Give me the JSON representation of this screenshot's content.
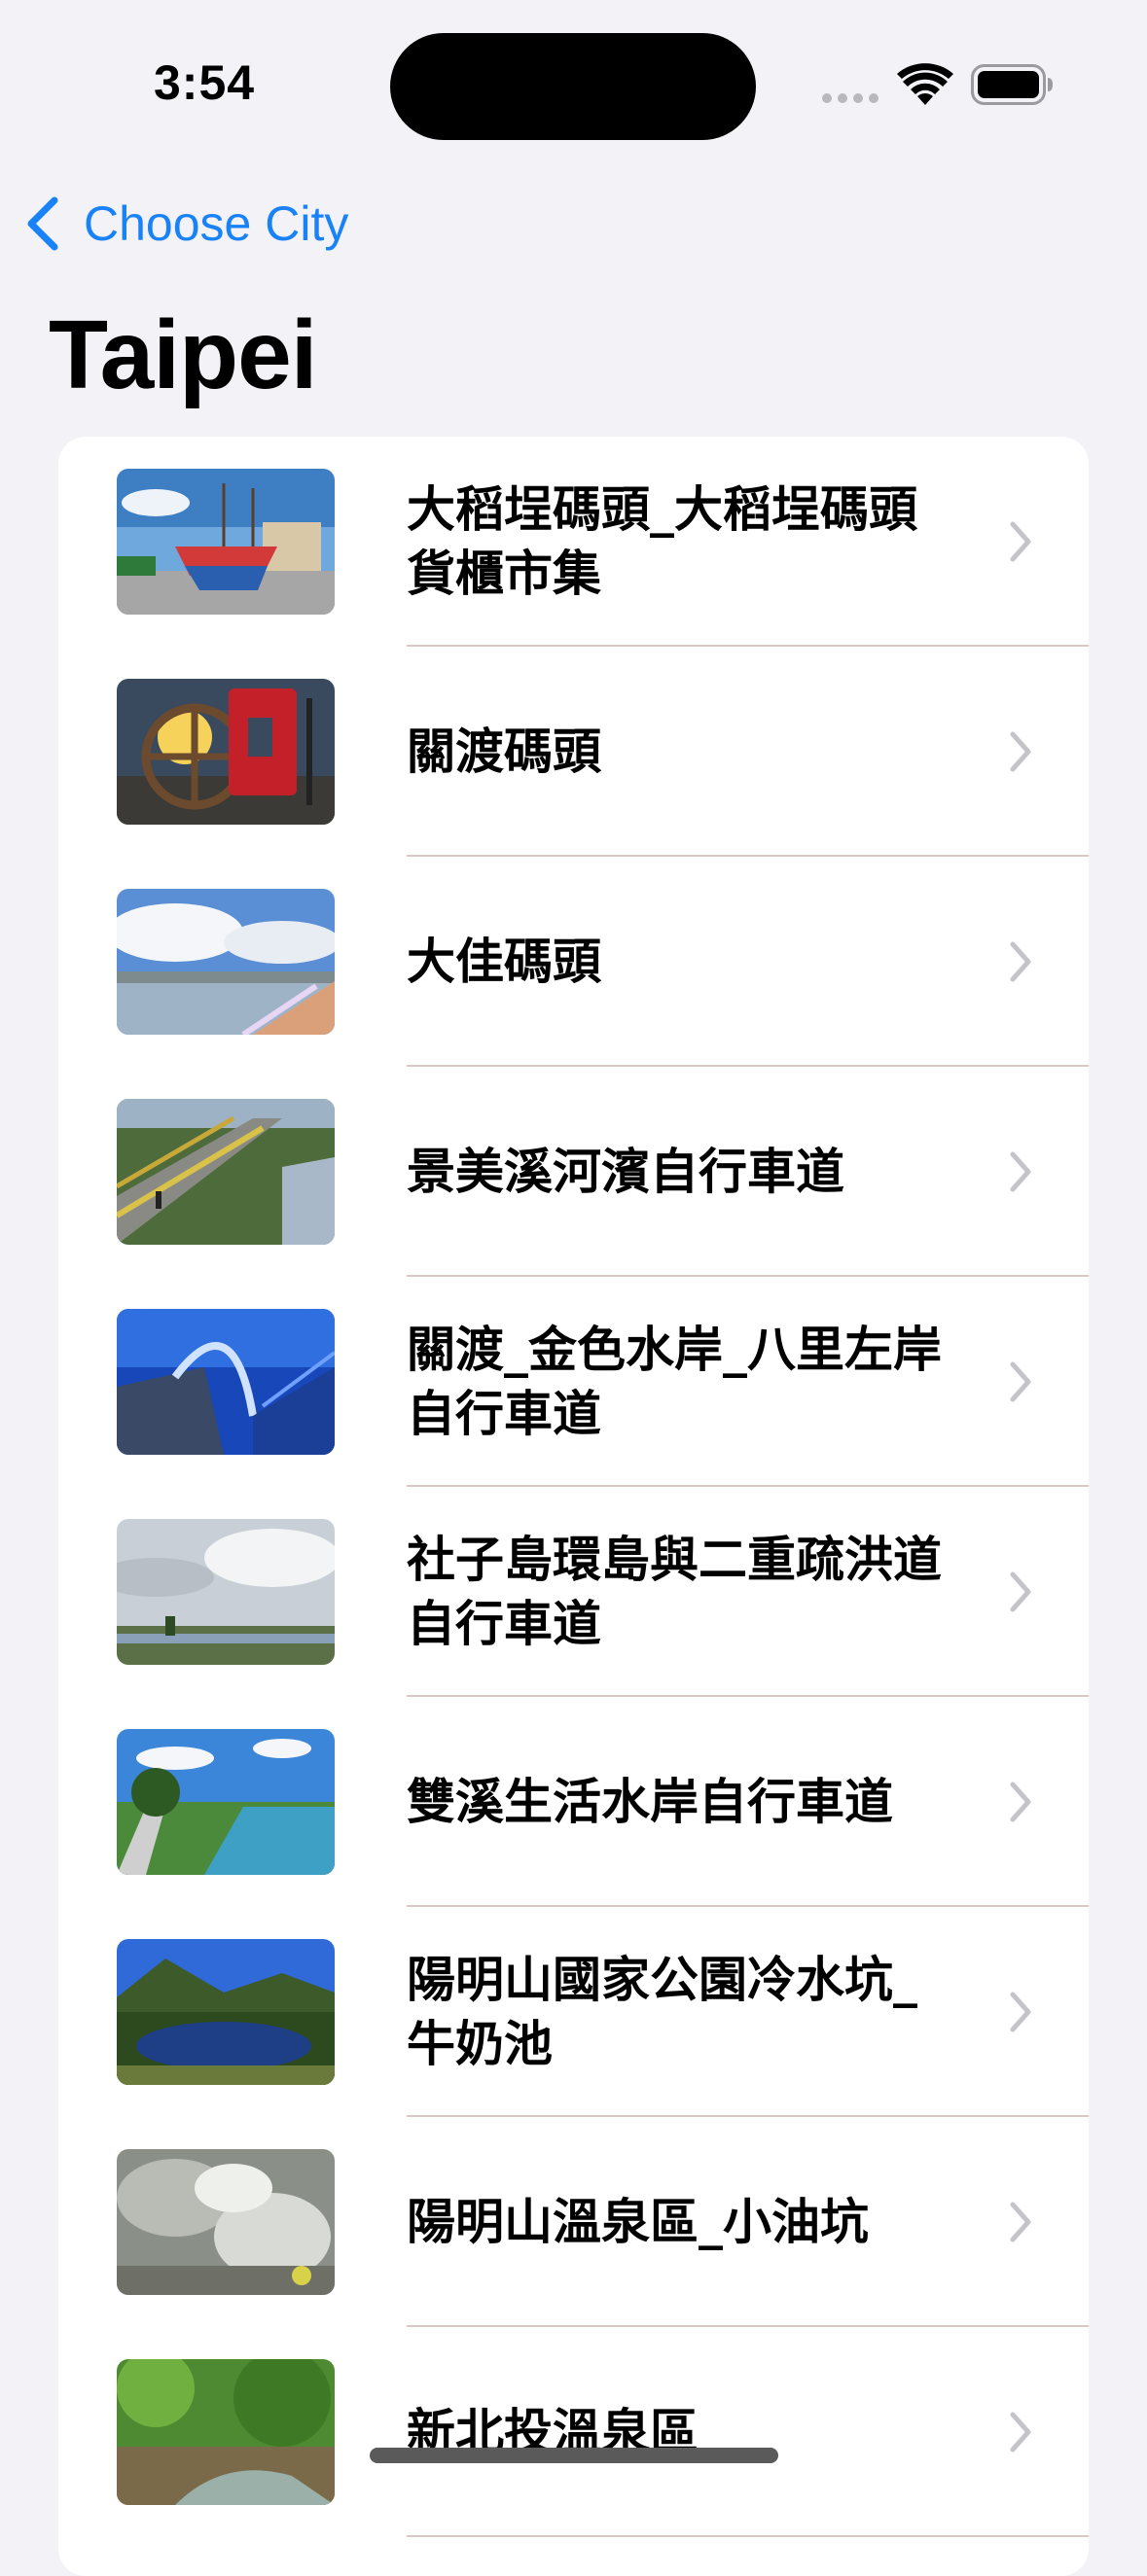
{
  "status_bar": {
    "time": "3:54"
  },
  "nav": {
    "back_label": "Choose City",
    "title": "Taipei"
  },
  "colors": {
    "accent": "#1a82f7",
    "background": "#f2f2f7",
    "separator": "#d9c8bf"
  },
  "items": [
    {
      "label": "大稻埕碼頭_大稻埕碼頭貨櫃市集",
      "thumbnail_icon": "ship-photo"
    },
    {
      "label": "關渡碼頭",
      "thumbnail_icon": "ship-wheel-photo"
    },
    {
      "label": "大佳碼頭",
      "thumbnail_icon": "riverside-photo"
    },
    {
      "label": "景美溪河濱自行車道",
      "thumbnail_icon": "bike-path-photo"
    },
    {
      "label": "關渡_金色水岸_八里左岸自行車道",
      "thumbnail_icon": "bridge-photo"
    },
    {
      "label": "社子島環島與二重疏洪道自行車道",
      "thumbnail_icon": "cloudy-river-photo"
    },
    {
      "label": "雙溪生活水岸自行車道",
      "thumbnail_icon": "river-path-photo"
    },
    {
      "label": "陽明山國家公園冷水坑_牛奶池",
      "thumbnail_icon": "mountain-lake-photo"
    },
    {
      "label": "陽明山溫泉區_小油坑",
      "thumbnail_icon": "sulfur-vent-photo"
    },
    {
      "label": "新北投溫泉區",
      "thumbnail_icon": "forest-stream-photo"
    }
  ]
}
